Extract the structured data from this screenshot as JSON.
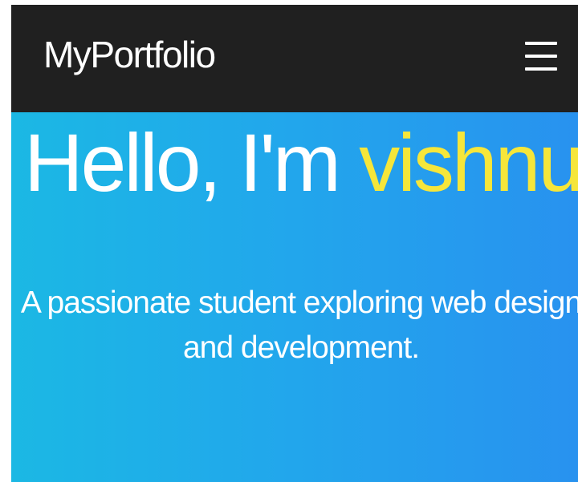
{
  "navbar": {
    "brand": "MyPortfolio",
    "menu_icon": "hamburger-menu-icon"
  },
  "hero": {
    "greeting": "Hello, I'm",
    "name": "vishnu",
    "subtitle_line1": "A passionate student exploring web design",
    "subtitle_line2": "and development."
  },
  "colors": {
    "navbar_bg": "#202020",
    "hero_gradient_start": "#1bb8e4",
    "hero_gradient_end": "#2892ef",
    "name_accent": "#f6e63a",
    "text": "#ffffff"
  }
}
